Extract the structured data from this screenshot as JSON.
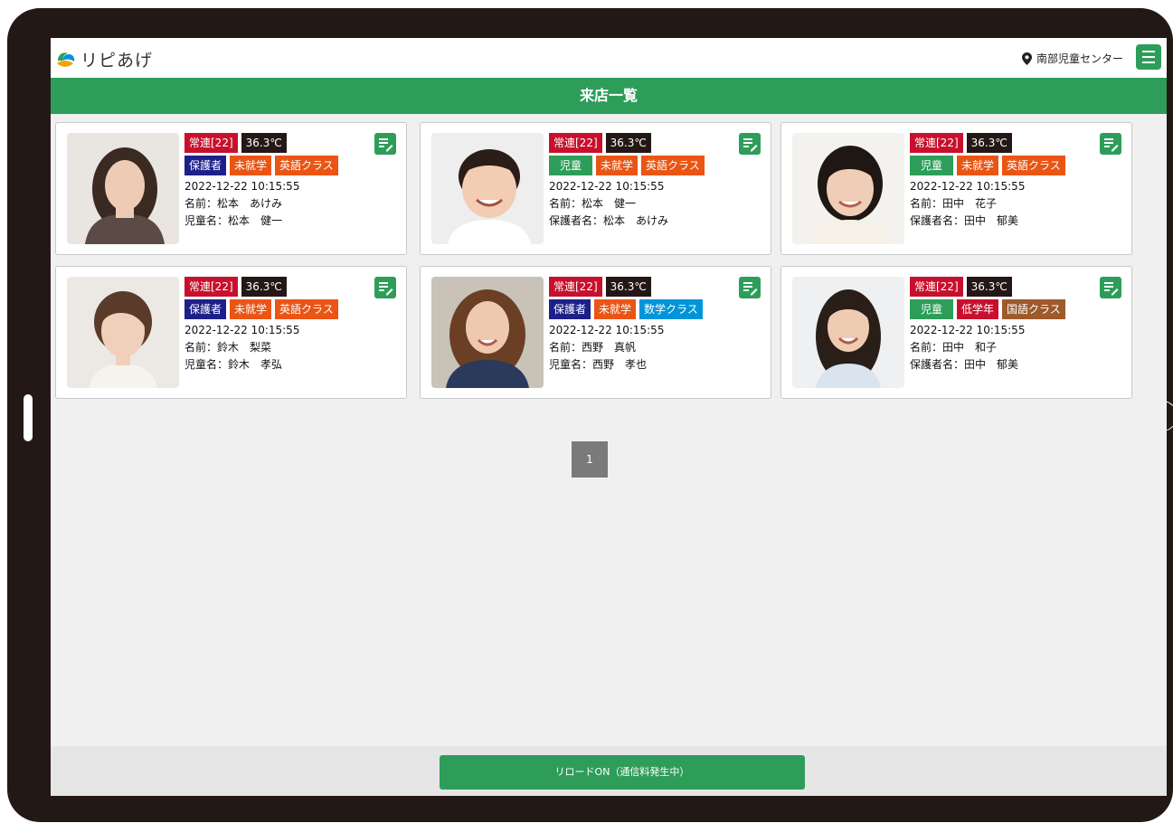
{
  "header": {
    "logo_text": "リピあげ",
    "location": "南部児童センター"
  },
  "title": "来店一覧",
  "cards": [
    {
      "regular": "常連[22]",
      "temp": "36.3℃",
      "type": "保護者",
      "school": "未就学",
      "class": "英語クラス",
      "datetime": "2022-12-22 10:15:55",
      "name": "名前：松本　あけみ",
      "relation": "児童名：松本　健一"
    },
    {
      "regular": "常連[22]",
      "temp": "36.3℃",
      "type": "児童",
      "school": "未就学",
      "class": "英語クラス",
      "datetime": "2022-12-22 10:15:55",
      "name": "名前：松本　健一",
      "relation": "保護者名：松本　あけみ"
    },
    {
      "regular": "常連[22]",
      "temp": "36.3℃",
      "type": "児童",
      "school": "未就学",
      "class": "英語クラス",
      "datetime": "2022-12-22 10:15:55",
      "name": "名前：田中　花子",
      "relation": "保護者名：田中　郁美"
    },
    {
      "regular": "常連[22]",
      "temp": "36.3℃",
      "type": "保護者",
      "school": "未就学",
      "class": "英語クラス",
      "datetime": "2022-12-22 10:15:55",
      "name": "名前：鈴木　梨菜",
      "relation": "児童名：鈴木　孝弘"
    },
    {
      "regular": "常連[22]",
      "temp": "36.3℃",
      "type": "保護者",
      "school": "未就学",
      "class": "数学クラス",
      "datetime": "2022-12-22 10:15:55",
      "name": "名前：西野　真帆",
      "relation": "児童名：西野　孝也"
    },
    {
      "regular": "常連[22]",
      "temp": "36.3℃",
      "type": "児童",
      "school": "低学年",
      "class": "国語クラス",
      "datetime": "2022-12-22 10:15:55",
      "name": "名前：田中　和子",
      "relation": "保護者名：田中　郁美"
    }
  ],
  "pagination": {
    "current": "1"
  },
  "footer": {
    "reload_label": "リロードON（通信料発生中）"
  },
  "colors": {
    "accent": "#2e9d5a",
    "regular": "#c8102e",
    "guardian": "#1d2088",
    "orange": "#ea5514",
    "math": "#0095d9",
    "japanese": "#9e5a2b"
  }
}
